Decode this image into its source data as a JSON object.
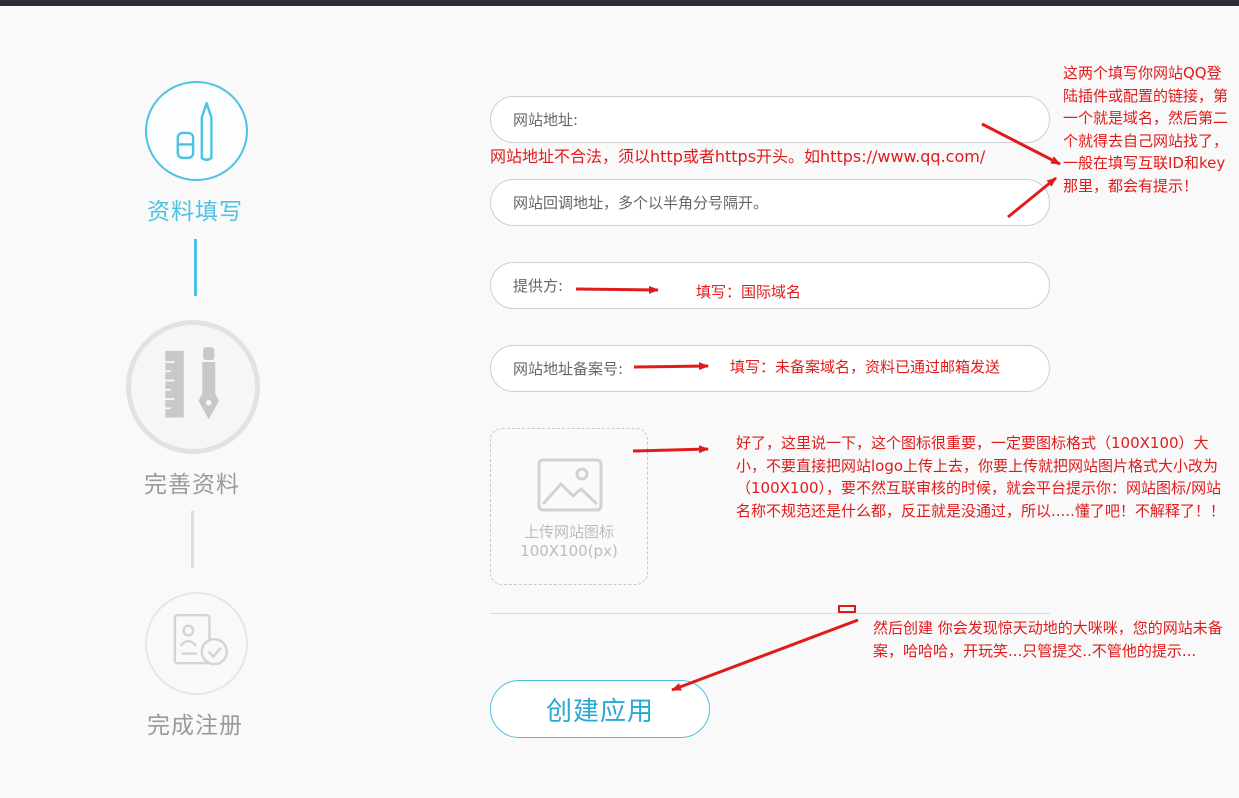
{
  "steps": [
    {
      "label": "资料填写",
      "state": "active",
      "icon": "pen-ink-icon"
    },
    {
      "label": "完善资料",
      "state": "inactive",
      "icon": "ruler-pen-icon"
    },
    {
      "label": "完成注册",
      "state": "inactive",
      "icon": "document-check-icon"
    }
  ],
  "form": {
    "website_url": {
      "placeholder": "网站地址:"
    },
    "url_error": "网站地址不合法，须以http或者https开头。如https://www.qq.com/",
    "callback_url": {
      "placeholder": "网站回调地址，多个以半角分号隔开。"
    },
    "provider": {
      "placeholder": "提供方:"
    },
    "icp_record": {
      "placeholder": "网站地址备案号:"
    },
    "upload": {
      "line1": "上传网站图标",
      "line2": "100X100(px)",
      "icon": "image-icon"
    },
    "create_button": "创建应用"
  },
  "annotations": {
    "top_right": "这两个填写你网站QQ登陆插件或配置的链接，第一个就是域名，然后第二个就得去自己网站找了，一般在填写互联ID和key那里，都会有提示！",
    "provider_hint": "填写：国际域名",
    "record_hint": "填写：未备案域名，资料已通过邮箱发送",
    "icon_hint": "好了，这里说一下，这个图标很重要，一定要图标格式（100X100）大小，不要直接把网站logo上传上去，你要上传就把网站图片格式大小改为（100X100），要不然互联审核的时候，就会平台提示你：网站图标/网站名称不规范还是什么都，反正就是没通过，所以.....懂了吧！不解释了！！",
    "create_hint": "然后创建 你会发现惊天动地的大咪咪，您的网站未备案，哈哈哈，开玩笑...只管提交..不管他的提示..."
  },
  "colors": {
    "accent": "#4fc2e3",
    "annotation": "#e01b1b",
    "inactive": "#9a9a9a"
  }
}
